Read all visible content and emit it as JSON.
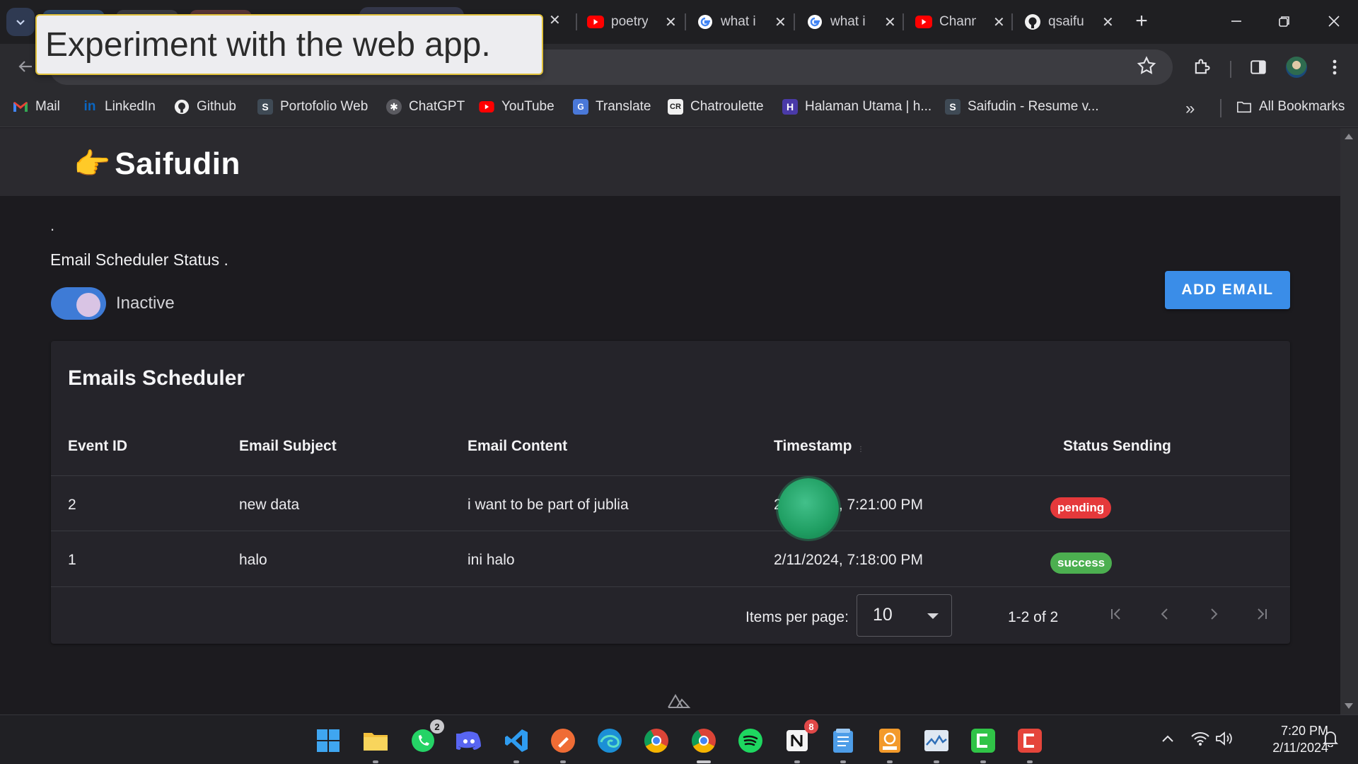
{
  "browser": {
    "tabs": [
      {
        "title": "poetry",
        "icon": "youtube-icon"
      },
      {
        "title": "what i",
        "icon": "google-icon"
      },
      {
        "title": "what i",
        "icon": "google-icon"
      },
      {
        "title": "Channel",
        "icon": "youtube-icon"
      },
      {
        "title": "qsaifu",
        "icon": "github-icon"
      }
    ],
    "tooltip": "Experiment with the web app.",
    "bookmarks": [
      {
        "label": "Mail",
        "icon": "gmail-icon"
      },
      {
        "label": "LinkedIn",
        "icon": "linkedin-icon"
      },
      {
        "label": "Github",
        "icon": "github-icon"
      },
      {
        "label": "Portofolio Web",
        "icon": "s-icon"
      },
      {
        "label": "ChatGPT",
        "icon": "chatgpt-icon"
      },
      {
        "label": "YouTube",
        "icon": "youtube-icon"
      },
      {
        "label": "Translate",
        "icon": "translate-icon"
      },
      {
        "label": "Chatroulette",
        "icon": "chatroulette-icon"
      },
      {
        "label": "Halaman Utama | h...",
        "icon": "h-icon"
      },
      {
        "label": "Saifudin - Resume v...",
        "icon": "s-icon"
      }
    ],
    "bookmarks_more": "»",
    "all_bookmarks": "All Bookmarks"
  },
  "app": {
    "brand": "Saifudin",
    "brand_emoji": "👉",
    "dot": ".",
    "scheduler_status_label": "Email Scheduler Status .",
    "toggle_label": "Inactive",
    "add_button": "ADD EMAIL",
    "colors": {
      "accent": "#3a8de8",
      "pending": "#e5393b",
      "success": "#4caf50"
    }
  },
  "table": {
    "title": "Emails Scheduler",
    "columns": [
      "Event ID",
      "Email Subject",
      "Email Content",
      "Timestamp",
      "Status Sending"
    ],
    "rows": [
      {
        "id": "2",
        "subject": "new data",
        "content": "i want to be part of jublia",
        "timestamp": "2/11/2024, 7:21:00 PM",
        "status": "pending"
      },
      {
        "id": "1",
        "subject": "halo",
        "content": "ini halo",
        "timestamp": "2/11/2024, 7:18:00 PM",
        "status": "success"
      }
    ],
    "pagination": {
      "items_per_page_label": "Items per page:",
      "items_per_page_value": "10",
      "range_label": "1-2 of 2"
    }
  },
  "taskbar": {
    "whatsapp_badge": "2",
    "notion_badge": "8",
    "time": "7:20 PM",
    "date": "2/11/2024"
  }
}
